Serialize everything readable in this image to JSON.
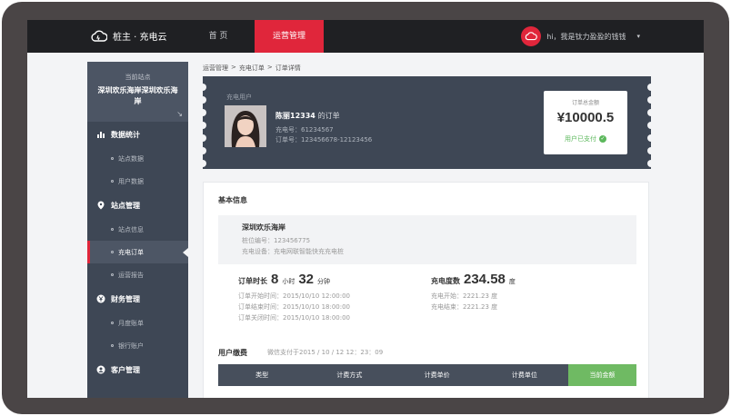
{
  "topbar": {
    "brand": "桩主 · 充电云",
    "nav": {
      "home": "首 页",
      "operations": "运营管理"
    },
    "user_greeting": "hi，我是钛力盈盈的钱钱",
    "caret": "▾"
  },
  "sidebar": {
    "station_label": "当前站点",
    "station_name": "深圳欢乐海岸深圳欢乐海岸",
    "expand_icon": "↘",
    "sections": [
      {
        "label": "数据统计",
        "items": [
          "站点数据",
          "用户数据"
        ]
      },
      {
        "label": "站点管理",
        "items": [
          "站点信息",
          "充电订单",
          "运营报告"
        ]
      },
      {
        "label": "财务管理",
        "items": [
          "月度账单",
          "银行账户"
        ]
      },
      {
        "label": "客户管理",
        "items": []
      }
    ],
    "active_item": "充电订单"
  },
  "breadcrumb": [
    "运营管理",
    ">",
    "充电订单",
    ">",
    "订单详情"
  ],
  "ticket": {
    "label": "充电用户",
    "order_title": "陈丽12334",
    "order_suffix": "的订单",
    "charge_no": "充电号：61234567",
    "order_no": "订单号：123456678-12123456",
    "amount_label": "订单总金额",
    "amount": "¥10000.5",
    "paid_status": "用户已支付",
    "check": "✓"
  },
  "basic": {
    "title": "基本信息",
    "station_name": "深圳欢乐海岸",
    "pile_no": "桩位编号：123456775",
    "device": "充电设备：充电网联智能快充充电桩"
  },
  "stats": {
    "duration_label": "订单时长",
    "hours": "8",
    "hours_unit": "小时",
    "minutes": "32",
    "minutes_unit": "分钟",
    "start_time": "订单开始时间：2015/10/10  12:00:00",
    "end_time": "订单结束时间：2015/10/10  18:00:00",
    "close_time": "订单关闭时间：2015/10/10  18:00:00",
    "energy_label": "充电度数",
    "energy": "234.58",
    "energy_unit": "度",
    "start_reading": "充电开始：2221.23 度",
    "end_reading": "充电结束：2221.23 度"
  },
  "fees": {
    "title": "用户缴费",
    "subtitle": "微信支付于2015 / 10 / 12 12：23：09",
    "columns": [
      "类型",
      "计费方式",
      "计费单价",
      "计费单位",
      "当前金额"
    ]
  },
  "colors": {
    "accent": "#e0263b",
    "sidebar": "#3e4755",
    "success": "#6fba63"
  }
}
